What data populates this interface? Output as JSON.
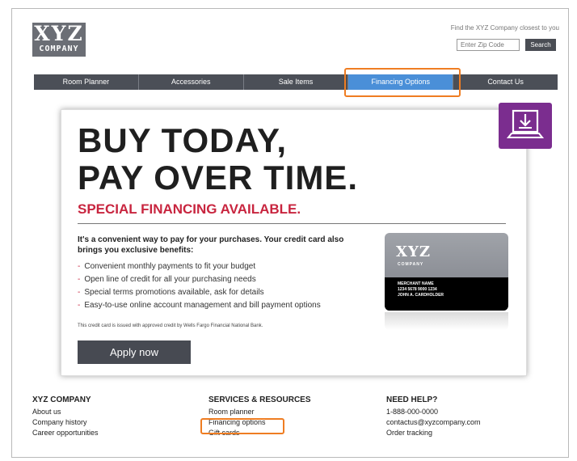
{
  "header": {
    "logo_main": "XYZ",
    "logo_sub": "COMPANY",
    "find_text": "Find the XYZ Company closest to you",
    "zip_placeholder": "Enter Zip Code",
    "search_label": "Search"
  },
  "nav": {
    "items": [
      {
        "label": "Room Planner"
      },
      {
        "label": "Accessories"
      },
      {
        "label": "Sale Items"
      },
      {
        "label": "Financing Options"
      },
      {
        "label": "Contact Us"
      }
    ],
    "active_index": 3
  },
  "promo": {
    "headline_1": "BUY TODAY,",
    "headline_2": "PAY OVER TIME.",
    "subheadline": "SPECIAL FINANCING AVAILABLE.",
    "intro": "It's a convenient way to pay for your purchases. Your credit card also brings you exclusive benefits:",
    "bullets": [
      "Convenient monthly payments to fit your budget",
      "Open line of credit for all your purchasing needs",
      "Special terms promotions available, ask for details",
      "Easy-to-use online account management and bill payment options"
    ],
    "fine_print": "This credit card is issued with approved credit by Wells Fargo Financial National Bank.",
    "apply_label": "Apply now"
  },
  "card": {
    "logo_main": "XYZ",
    "logo_sub": "COMPANY",
    "merchant": "MERCHANT NAME",
    "number": "1234 5678 9000 1234",
    "holder": "JOHN A. CARDHOLDER"
  },
  "footer": {
    "col1": {
      "title": "XYZ COMPANY",
      "links": [
        "About us",
        "Company history",
        "Career opportunities"
      ]
    },
    "col2": {
      "title": "SERVICES & RESOURCES",
      "links": [
        "Room planner",
        "Financing options",
        "Gift cards"
      ]
    },
    "col3": {
      "title": "NEED HELP?",
      "links": [
        "1-888-000-0000",
        "contactus@xyzcompany.com",
        "Order tracking"
      ]
    }
  },
  "icons": {
    "download": "download-laptop-icon"
  },
  "colors": {
    "accent_red": "#c8253f",
    "highlight_orange": "#ef7d22",
    "nav_dark": "#4b4f57",
    "nav_active": "#4a8fd8",
    "download_purple": "#7b2d8f"
  }
}
